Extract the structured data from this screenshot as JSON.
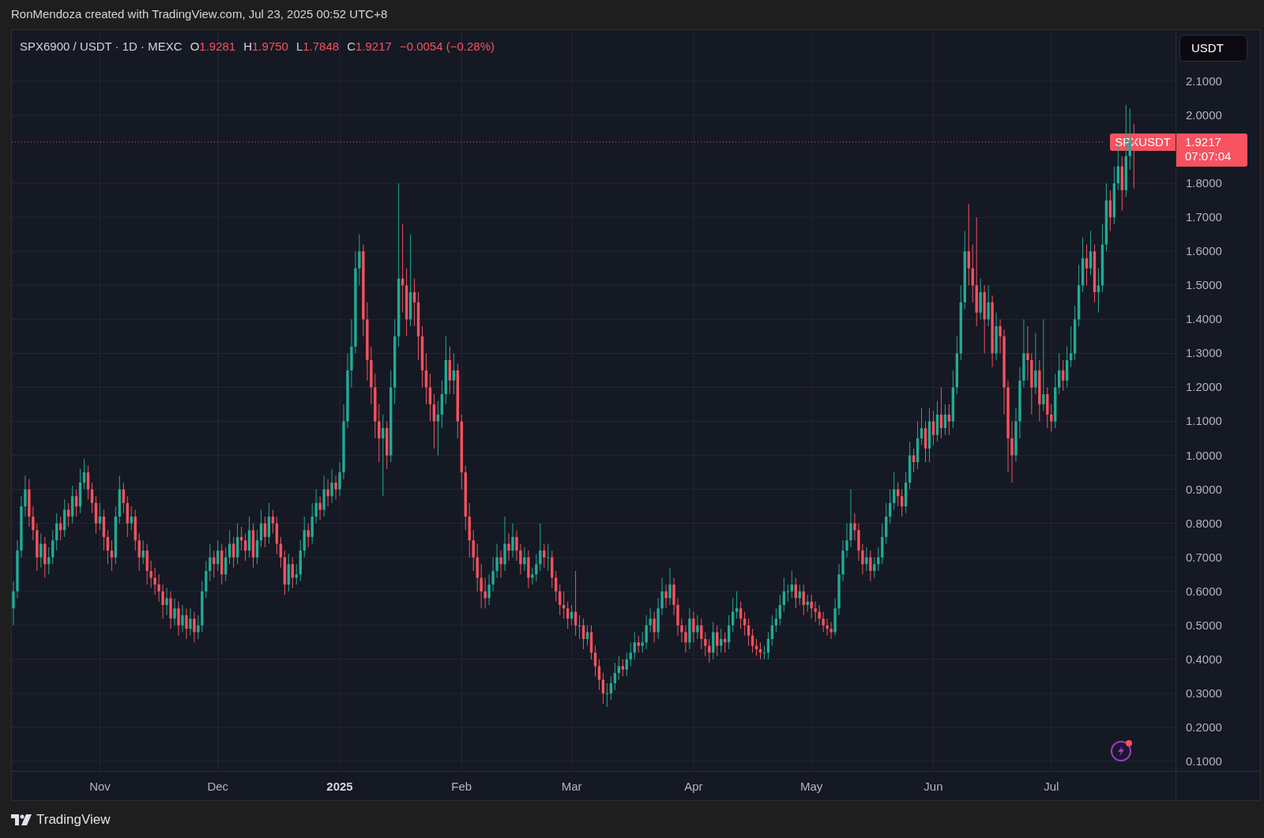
{
  "header": {
    "credit": "RonMendoza created with TradingView.com, Jul 23, 2025 00:52 UTC+8"
  },
  "legend": {
    "symbol": "SPX6900 / USDT · 1D · MEXC",
    "ohlc": [
      {
        "label": "O",
        "value": "1.9281"
      },
      {
        "label": "H",
        "value": "1.9750"
      },
      {
        "label": "L",
        "value": "1.7848"
      },
      {
        "label": "C",
        "value": "1.9217"
      }
    ],
    "change": "−0.0054 (−0.28%)"
  },
  "chart": {
    "chart_data": {
      "type": "candlestick",
      "ylim": [
        0.0721,
        2.251
      ],
      "grid": true,
      "ref_lines": [
        {
          "axis": "y",
          "value": 1.9217,
          "color": "#f7525f"
        }
      ],
      "categories": [
        null,
        null,
        null,
        null,
        null,
        null,
        null,
        null,
        null,
        null,
        null,
        null,
        null,
        null,
        null,
        null,
        null,
        null,
        null,
        null,
        null,
        null,
        "Nov",
        null,
        null,
        null,
        null,
        null,
        null,
        null,
        null,
        null,
        null,
        null,
        null,
        null,
        null,
        null,
        null,
        null,
        null,
        null,
        null,
        null,
        null,
        null,
        null,
        null,
        null,
        null,
        null,
        null,
        "Dec",
        null,
        null,
        null,
        null,
        null,
        null,
        null,
        null,
        null,
        null,
        null,
        null,
        null,
        null,
        null,
        null,
        null,
        null,
        null,
        null,
        null,
        null,
        null,
        null,
        null,
        null,
        null,
        null,
        null,
        null,
        "2025",
        null,
        null,
        null,
        null,
        null,
        null,
        null,
        null,
        null,
        null,
        null,
        null,
        null,
        null,
        null,
        null,
        null,
        null,
        null,
        null,
        null,
        null,
        null,
        null,
        null,
        null,
        null,
        null,
        null,
        null,
        "Feb",
        null,
        null,
        null,
        null,
        null,
        null,
        null,
        null,
        null,
        null,
        null,
        null,
        null,
        null,
        null,
        null,
        null,
        null,
        null,
        null,
        null,
        null,
        null,
        null,
        null,
        null,
        null,
        "Mar",
        null,
        null,
        null,
        null,
        null,
        null,
        null,
        null,
        null,
        null,
        null,
        null,
        null,
        null,
        null,
        null,
        null,
        null,
        null,
        null,
        null,
        null,
        null,
        null,
        null,
        null,
        null,
        null,
        null,
        null,
        "Apr",
        null,
        null,
        null,
        null,
        null,
        null,
        null,
        null,
        null,
        null,
        null,
        null,
        null,
        null,
        null,
        null,
        null,
        null,
        null,
        null,
        null,
        null,
        null,
        null,
        null,
        null,
        null,
        null,
        null,
        "May",
        null,
        null,
        null,
        null,
        null,
        null,
        null,
        null,
        null,
        null,
        null,
        null,
        null,
        null,
        null,
        null,
        null,
        null,
        null,
        null,
        null,
        null,
        null,
        null,
        null,
        null,
        null,
        null,
        null,
        null,
        "Jun",
        null,
        null,
        null,
        null,
        null,
        null,
        null,
        null,
        null,
        null,
        null,
        null,
        null,
        null,
        null,
        null,
        null,
        null,
        null,
        null,
        null,
        null,
        null,
        null,
        null,
        null,
        null,
        null,
        null,
        "Jul",
        null,
        null,
        null,
        null,
        null,
        null,
        null,
        null,
        null,
        null,
        null,
        null,
        null,
        null,
        null,
        null,
        null,
        null,
        null,
        null,
        null
      ],
      "yticks": [
        {
          "value": 2.1,
          "label": "2.1000"
        },
        {
          "value": 2.0,
          "label": "2.0000"
        },
        {
          "value": 1.8,
          "label": "1.8000"
        },
        {
          "value": 1.7,
          "label": "1.7000"
        },
        {
          "value": 1.6,
          "label": "1.6000"
        },
        {
          "value": 1.5,
          "label": "1.5000"
        },
        {
          "value": 1.4,
          "label": "1.4000"
        },
        {
          "value": 1.3,
          "label": "1.3000"
        },
        {
          "value": 1.2,
          "label": "1.2000"
        },
        {
          "value": 1.1,
          "label": "1.1000"
        },
        {
          "value": 1.0,
          "label": "1.0000"
        },
        {
          "value": 0.9,
          "label": "0.9000"
        },
        {
          "value": 0.8,
          "label": "0.8000"
        },
        {
          "value": 0.7,
          "label": "0.7000"
        },
        {
          "value": 0.6,
          "label": "0.6000"
        },
        {
          "value": 0.5,
          "label": "0.5000"
        },
        {
          "value": 0.4,
          "label": "0.4000"
        },
        {
          "value": 0.3,
          "label": "0.3000"
        },
        {
          "value": 0.2,
          "label": "0.2000"
        },
        {
          "value": 0.1,
          "label": "0.1000"
        }
      ],
      "ohlc": [
        [
          0.55,
          0.63,
          0.5,
          0.6
        ],
        [
          0.6,
          0.75,
          0.58,
          0.72
        ],
        [
          0.72,
          0.88,
          0.7,
          0.85
        ],
        [
          0.85,
          0.94,
          0.82,
          0.9
        ],
        [
          0.9,
          0.93,
          0.79,
          0.82
        ],
        [
          0.82,
          0.85,
          0.75,
          0.78
        ],
        [
          0.78,
          0.8,
          0.66,
          0.7
        ],
        [
          0.7,
          0.77,
          0.67,
          0.74
        ],
        [
          0.74,
          0.76,
          0.64,
          0.68
        ],
        [
          0.68,
          0.73,
          0.65,
          0.7
        ],
        [
          0.7,
          0.78,
          0.68,
          0.75
        ],
        [
          0.75,
          0.83,
          0.72,
          0.8
        ],
        [
          0.8,
          0.82,
          0.75,
          0.78
        ],
        [
          0.78,
          0.87,
          0.76,
          0.84
        ],
        [
          0.84,
          0.86,
          0.79,
          0.82
        ],
        [
          0.82,
          0.91,
          0.8,
          0.88
        ],
        [
          0.88,
          0.9,
          0.82,
          0.85
        ],
        [
          0.85,
          0.96,
          0.83,
          0.92
        ],
        [
          0.92,
          0.99,
          0.9,
          0.95
        ],
        [
          0.95,
          0.97,
          0.87,
          0.9
        ],
        [
          0.9,
          0.92,
          0.83,
          0.86
        ],
        [
          0.86,
          0.88,
          0.77,
          0.8
        ],
        [
          0.8,
          0.86,
          0.78,
          0.82
        ],
        [
          0.82,
          0.84,
          0.72,
          0.76
        ],
        [
          0.76,
          0.78,
          0.68,
          0.72
        ],
        [
          0.72,
          0.75,
          0.66,
          0.7
        ],
        [
          0.7,
          0.85,
          0.68,
          0.82
        ],
        [
          0.82,
          0.94,
          0.8,
          0.9
        ],
        [
          0.9,
          0.92,
          0.83,
          0.86
        ],
        [
          0.86,
          0.88,
          0.76,
          0.8
        ],
        [
          0.8,
          0.85,
          0.78,
          0.82
        ],
        [
          0.82,
          0.84,
          0.72,
          0.75
        ],
        [
          0.75,
          0.77,
          0.66,
          0.7
        ],
        [
          0.7,
          0.75,
          0.68,
          0.72
        ],
        [
          0.72,
          0.74,
          0.62,
          0.66
        ],
        [
          0.66,
          0.69,
          0.61,
          0.64
        ],
        [
          0.64,
          0.67,
          0.59,
          0.62
        ],
        [
          0.62,
          0.65,
          0.57,
          0.6
        ],
        [
          0.6,
          0.62,
          0.52,
          0.56
        ],
        [
          0.56,
          0.61,
          0.53,
          0.58
        ],
        [
          0.58,
          0.6,
          0.49,
          0.52
        ],
        [
          0.52,
          0.58,
          0.5,
          0.55
        ],
        [
          0.55,
          0.57,
          0.47,
          0.5
        ],
        [
          0.5,
          0.56,
          0.48,
          0.53
        ],
        [
          0.53,
          0.55,
          0.46,
          0.49
        ],
        [
          0.49,
          0.55,
          0.47,
          0.52
        ],
        [
          0.52,
          0.54,
          0.45,
          0.48
        ],
        [
          0.48,
          0.53,
          0.46,
          0.5
        ],
        [
          0.5,
          0.63,
          0.48,
          0.6
        ],
        [
          0.6,
          0.69,
          0.58,
          0.66
        ],
        [
          0.66,
          0.74,
          0.63,
          0.7
        ],
        [
          0.7,
          0.72,
          0.64,
          0.68
        ],
        [
          0.68,
          0.75,
          0.66,
          0.72
        ],
        [
          0.72,
          0.74,
          0.62,
          0.65
        ],
        [
          0.65,
          0.73,
          0.63,
          0.7
        ],
        [
          0.7,
          0.78,
          0.68,
          0.74
        ],
        [
          0.74,
          0.76,
          0.67,
          0.7
        ],
        [
          0.7,
          0.8,
          0.68,
          0.76
        ],
        [
          0.76,
          0.79,
          0.72,
          0.75
        ],
        [
          0.75,
          0.77,
          0.69,
          0.72
        ],
        [
          0.72,
          0.82,
          0.7,
          0.78
        ],
        [
          0.78,
          0.8,
          0.67,
          0.7
        ],
        [
          0.7,
          0.78,
          0.68,
          0.75
        ],
        [
          0.75,
          0.84,
          0.73,
          0.8
        ],
        [
          0.8,
          0.82,
          0.73,
          0.76
        ],
        [
          0.76,
          0.86,
          0.74,
          0.82
        ],
        [
          0.82,
          0.84,
          0.77,
          0.8
        ],
        [
          0.8,
          0.82,
          0.71,
          0.74
        ],
        [
          0.74,
          0.76,
          0.67,
          0.7
        ],
        [
          0.7,
          0.72,
          0.59,
          0.62
        ],
        [
          0.62,
          0.71,
          0.6,
          0.68
        ],
        [
          0.68,
          0.7,
          0.61,
          0.64
        ],
        [
          0.64,
          0.68,
          0.62,
          0.65
        ],
        [
          0.65,
          0.75,
          0.63,
          0.72
        ],
        [
          0.72,
          0.82,
          0.7,
          0.78
        ],
        [
          0.78,
          0.8,
          0.73,
          0.76
        ],
        [
          0.76,
          0.86,
          0.74,
          0.82
        ],
        [
          0.82,
          0.9,
          0.8,
          0.86
        ],
        [
          0.86,
          0.88,
          0.81,
          0.84
        ],
        [
          0.84,
          0.94,
          0.82,
          0.9
        ],
        [
          0.9,
          0.93,
          0.85,
          0.88
        ],
        [
          0.88,
          0.96,
          0.86,
          0.92
        ],
        [
          0.92,
          0.94,
          0.87,
          0.9
        ],
        [
          0.9,
          0.98,
          0.88,
          0.95
        ],
        [
          0.95,
          1.15,
          0.93,
          1.1
        ],
        [
          1.1,
          1.3,
          1.08,
          1.25
        ],
        [
          1.25,
          1.4,
          1.2,
          1.32
        ],
        [
          1.32,
          1.6,
          1.3,
          1.55
        ],
        [
          1.55,
          1.65,
          1.5,
          1.6
        ],
        [
          1.6,
          1.62,
          1.35,
          1.4
        ],
        [
          1.4,
          1.45,
          1.22,
          1.28
        ],
        [
          1.28,
          1.32,
          1.15,
          1.2
        ],
        [
          1.2,
          1.24,
          1.05,
          1.1
        ],
        [
          1.1,
          1.15,
          0.98,
          1.05
        ],
        [
          1.05,
          1.12,
          0.88,
          1.08
        ],
        [
          1.08,
          1.1,
          0.96,
          1.0
        ],
        [
          1.0,
          1.25,
          0.98,
          1.2
        ],
        [
          1.2,
          1.4,
          1.15,
          1.35
        ],
        [
          1.35,
          1.8,
          1.32,
          1.52
        ],
        [
          1.52,
          1.68,
          1.42,
          1.5
        ],
        [
          1.5,
          1.55,
          1.35,
          1.4
        ],
        [
          1.4,
          1.65,
          1.38,
          1.48
        ],
        [
          1.48,
          1.52,
          1.38,
          1.45
        ],
        [
          1.45,
          1.48,
          1.28,
          1.35
        ],
        [
          1.35,
          1.38,
          1.2,
          1.25
        ],
        [
          1.25,
          1.3,
          1.15,
          1.2
        ],
        [
          1.2,
          1.24,
          1.1,
          1.15
        ],
        [
          1.15,
          1.18,
          1.02,
          1.1
        ],
        [
          1.1,
          1.16,
          1.0,
          1.12
        ],
        [
          1.12,
          1.22,
          1.08,
          1.18
        ],
        [
          1.18,
          1.35,
          1.15,
          1.28
        ],
        [
          1.28,
          1.32,
          1.18,
          1.22
        ],
        [
          1.22,
          1.3,
          1.18,
          1.25
        ],
        [
          1.25,
          1.27,
          1.05,
          1.1
        ],
        [
          1.1,
          1.12,
          0.9,
          0.95
        ],
        [
          0.95,
          0.97,
          0.78,
          0.82
        ],
        [
          0.82,
          0.86,
          0.7,
          0.75
        ],
        [
          0.75,
          0.78,
          0.66,
          0.7
        ],
        [
          0.7,
          0.74,
          0.6,
          0.64
        ],
        [
          0.64,
          0.68,
          0.55,
          0.6
        ],
        [
          0.6,
          0.64,
          0.55,
          0.58
        ],
        [
          0.58,
          0.65,
          0.56,
          0.62
        ],
        [
          0.62,
          0.7,
          0.6,
          0.66
        ],
        [
          0.66,
          0.74,
          0.64,
          0.7
        ],
        [
          0.7,
          0.72,
          0.64,
          0.68
        ],
        [
          0.68,
          0.82,
          0.66,
          0.74
        ],
        [
          0.74,
          0.77,
          0.69,
          0.72
        ],
        [
          0.72,
          0.8,
          0.7,
          0.76
        ],
        [
          0.76,
          0.78,
          0.69,
          0.72
        ],
        [
          0.72,
          0.74,
          0.65,
          0.68
        ],
        [
          0.68,
          0.73,
          0.66,
          0.7
        ],
        [
          0.7,
          0.72,
          0.61,
          0.64
        ],
        [
          0.64,
          0.67,
          0.62,
          0.65
        ],
        [
          0.65,
          0.71,
          0.63,
          0.68
        ],
        [
          0.68,
          0.8,
          0.66,
          0.72
        ],
        [
          0.72,
          0.74,
          0.67,
          0.7
        ],
        [
          0.7,
          0.74,
          0.66,
          0.7
        ],
        [
          0.7,
          0.72,
          0.61,
          0.64
        ],
        [
          0.64,
          0.66,
          0.57,
          0.6
        ],
        [
          0.6,
          0.62,
          0.53,
          0.56
        ],
        [
          0.56,
          0.6,
          0.52,
          0.55
        ],
        [
          0.55,
          0.57,
          0.49,
          0.52
        ],
        [
          0.52,
          0.56,
          0.5,
          0.54
        ],
        [
          0.54,
          0.66,
          0.47,
          0.5
        ],
        [
          0.5,
          0.53,
          0.46,
          0.5
        ],
        [
          0.5,
          0.52,
          0.43,
          0.46
        ],
        [
          0.46,
          0.5,
          0.44,
          0.48
        ],
        [
          0.48,
          0.5,
          0.4,
          0.42
        ],
        [
          0.42,
          0.44,
          0.35,
          0.38
        ],
        [
          0.38,
          0.4,
          0.31,
          0.34
        ],
        [
          0.34,
          0.36,
          0.27,
          0.3
        ],
        [
          0.3,
          0.33,
          0.26,
          0.3
        ],
        [
          0.3,
          0.35,
          0.28,
          0.33
        ],
        [
          0.33,
          0.39,
          0.31,
          0.36
        ],
        [
          0.36,
          0.41,
          0.34,
          0.38
        ],
        [
          0.38,
          0.4,
          0.35,
          0.37
        ],
        [
          0.37,
          0.42,
          0.35,
          0.4
        ],
        [
          0.4,
          0.45,
          0.38,
          0.42
        ],
        [
          0.42,
          0.48,
          0.4,
          0.45
        ],
        [
          0.45,
          0.47,
          0.42,
          0.44
        ],
        [
          0.44,
          0.48,
          0.42,
          0.45
        ],
        [
          0.45,
          0.53,
          0.43,
          0.5
        ],
        [
          0.5,
          0.55,
          0.48,
          0.52
        ],
        [
          0.52,
          0.54,
          0.45,
          0.48
        ],
        [
          0.48,
          0.58,
          0.46,
          0.55
        ],
        [
          0.55,
          0.64,
          0.53,
          0.6
        ],
        [
          0.6,
          0.62,
          0.55,
          0.58
        ],
        [
          0.58,
          0.67,
          0.56,
          0.62
        ],
        [
          0.62,
          0.64,
          0.53,
          0.56
        ],
        [
          0.56,
          0.58,
          0.47,
          0.5
        ],
        [
          0.5,
          0.52,
          0.45,
          0.48
        ],
        [
          0.48,
          0.5,
          0.42,
          0.45
        ],
        [
          0.45,
          0.55,
          0.43,
          0.52
        ],
        [
          0.52,
          0.54,
          0.45,
          0.48
        ],
        [
          0.48,
          0.53,
          0.46,
          0.5
        ],
        [
          0.5,
          0.52,
          0.43,
          0.46
        ],
        [
          0.46,
          0.48,
          0.41,
          0.44
        ],
        [
          0.44,
          0.46,
          0.39,
          0.42
        ],
        [
          0.42,
          0.51,
          0.4,
          0.48
        ],
        [
          0.48,
          0.5,
          0.41,
          0.44
        ],
        [
          0.44,
          0.49,
          0.42,
          0.46
        ],
        [
          0.46,
          0.48,
          0.42,
          0.45
        ],
        [
          0.45,
          0.53,
          0.43,
          0.5
        ],
        [
          0.5,
          0.58,
          0.48,
          0.54
        ],
        [
          0.54,
          0.6,
          0.52,
          0.55
        ],
        [
          0.55,
          0.57,
          0.49,
          0.52
        ],
        [
          0.52,
          0.54,
          0.47,
          0.5
        ],
        [
          0.5,
          0.52,
          0.44,
          0.47
        ],
        [
          0.47,
          0.49,
          0.42,
          0.44
        ],
        [
          0.44,
          0.46,
          0.41,
          0.43
        ],
        [
          0.43,
          0.45,
          0.4,
          0.42
        ],
        [
          0.42,
          0.44,
          0.4,
          0.42
        ],
        [
          0.42,
          0.48,
          0.4,
          0.46
        ],
        [
          0.46,
          0.53,
          0.44,
          0.5
        ],
        [
          0.5,
          0.55,
          0.48,
          0.52
        ],
        [
          0.52,
          0.59,
          0.5,
          0.56
        ],
        [
          0.56,
          0.64,
          0.54,
          0.6
        ],
        [
          0.6,
          0.62,
          0.57,
          0.6
        ],
        [
          0.6,
          0.66,
          0.58,
          0.62
        ],
        [
          0.62,
          0.64,
          0.55,
          0.58
        ],
        [
          0.58,
          0.62,
          0.56,
          0.6
        ],
        [
          0.6,
          0.62,
          0.53,
          0.56
        ],
        [
          0.56,
          0.59,
          0.54,
          0.57
        ],
        [
          0.57,
          0.59,
          0.52,
          0.55
        ],
        [
          0.55,
          0.57,
          0.51,
          0.54
        ],
        [
          0.54,
          0.56,
          0.5,
          0.52
        ],
        [
          0.52,
          0.54,
          0.48,
          0.5
        ],
        [
          0.5,
          0.52,
          0.47,
          0.49
        ],
        [
          0.49,
          0.51,
          0.46,
          0.48
        ],
        [
          0.48,
          0.58,
          0.47,
          0.55
        ],
        [
          0.55,
          0.68,
          0.53,
          0.65
        ],
        [
          0.65,
          0.75,
          0.63,
          0.72
        ],
        [
          0.72,
          0.8,
          0.7,
          0.75
        ],
        [
          0.75,
          0.9,
          0.73,
          0.8
        ],
        [
          0.8,
          0.83,
          0.75,
          0.78
        ],
        [
          0.78,
          0.8,
          0.69,
          0.72
        ],
        [
          0.72,
          0.74,
          0.65,
          0.68
        ],
        [
          0.68,
          0.73,
          0.66,
          0.7
        ],
        [
          0.7,
          0.72,
          0.63,
          0.66
        ],
        [
          0.66,
          0.7,
          0.64,
          0.68
        ],
        [
          0.68,
          0.73,
          0.66,
          0.7
        ],
        [
          0.7,
          0.8,
          0.68,
          0.76
        ],
        [
          0.76,
          0.86,
          0.74,
          0.82
        ],
        [
          0.82,
          0.9,
          0.8,
          0.86
        ],
        [
          0.86,
          0.95,
          0.84,
          0.9
        ],
        [
          0.9,
          0.92,
          0.85,
          0.88
        ],
        [
          0.88,
          0.9,
          0.82,
          0.85
        ],
        [
          0.85,
          0.95,
          0.83,
          0.92
        ],
        [
          0.92,
          1.04,
          0.9,
          1.0
        ],
        [
          1.0,
          1.02,
          0.95,
          0.98
        ],
        [
          0.98,
          1.1,
          0.96,
          1.05
        ],
        [
          1.05,
          1.14,
          1.03,
          1.08
        ],
        [
          1.08,
          1.1,
          0.98,
          1.02
        ],
        [
          1.02,
          1.14,
          0.98,
          1.1
        ],
        [
          1.1,
          1.13,
          1.03,
          1.06
        ],
        [
          1.06,
          1.16,
          1.04,
          1.12
        ],
        [
          1.12,
          1.2,
          1.05,
          1.08
        ],
        [
          1.08,
          1.15,
          1.06,
          1.12
        ],
        [
          1.12,
          1.15,
          1.06,
          1.1
        ],
        [
          1.1,
          1.25,
          1.08,
          1.2
        ],
        [
          1.2,
          1.35,
          1.18,
          1.3
        ],
        [
          1.3,
          1.5,
          1.28,
          1.45
        ],
        [
          1.45,
          1.66,
          1.43,
          1.6
        ],
        [
          1.6,
          1.74,
          1.5,
          1.55
        ],
        [
          1.55,
          1.62,
          1.45,
          1.5
        ],
        [
          1.5,
          1.7,
          1.38,
          1.42
        ],
        [
          1.42,
          1.52,
          1.4,
          1.48
        ],
        [
          1.48,
          1.5,
          1.3,
          1.4
        ],
        [
          1.4,
          1.5,
          1.38,
          1.45
        ],
        [
          1.45,
          1.47,
          1.26,
          1.3
        ],
        [
          1.3,
          1.42,
          1.28,
          1.38
        ],
        [
          1.38,
          1.4,
          1.3,
          1.35
        ],
        [
          1.35,
          1.37,
          1.12,
          1.2
        ],
        [
          1.2,
          1.22,
          0.95,
          1.05
        ],
        [
          1.05,
          1.1,
          0.92,
          1.0
        ],
        [
          1.0,
          1.14,
          0.98,
          1.1
        ],
        [
          1.1,
          1.26,
          1.05,
          1.22
        ],
        [
          1.22,
          1.4,
          1.2,
          1.3
        ],
        [
          1.3,
          1.38,
          1.22,
          1.28
        ],
        [
          1.28,
          1.3,
          1.12,
          1.2
        ],
        [
          1.2,
          1.36,
          1.18,
          1.25
        ],
        [
          1.25,
          1.28,
          1.1,
          1.15
        ],
        [
          1.15,
          1.4,
          1.13,
          1.18
        ],
        [
          1.18,
          1.2,
          1.08,
          1.12
        ],
        [
          1.12,
          1.15,
          1.07,
          1.1
        ],
        [
          1.1,
          1.24,
          1.08,
          1.2
        ],
        [
          1.2,
          1.3,
          1.18,
          1.25
        ],
        [
          1.25,
          1.28,
          1.19,
          1.22
        ],
        [
          1.22,
          1.32,
          1.2,
          1.28
        ],
        [
          1.28,
          1.38,
          1.26,
          1.3
        ],
        [
          1.3,
          1.44,
          1.28,
          1.4
        ],
        [
          1.4,
          1.56,
          1.38,
          1.5
        ],
        [
          1.5,
          1.64,
          1.48,
          1.58
        ],
        [
          1.58,
          1.62,
          1.5,
          1.55
        ],
        [
          1.55,
          1.66,
          1.53,
          1.6
        ],
        [
          1.6,
          1.62,
          1.45,
          1.48
        ],
        [
          1.48,
          1.55,
          1.42,
          1.5
        ],
        [
          1.5,
          1.68,
          1.48,
          1.62
        ],
        [
          1.62,
          1.8,
          1.6,
          1.75
        ],
        [
          1.75,
          1.78,
          1.66,
          1.7
        ],
        [
          1.7,
          1.85,
          1.68,
          1.8
        ],
        [
          1.8,
          1.92,
          1.78,
          1.85
        ],
        [
          1.85,
          1.88,
          1.72,
          1.78
        ],
        [
          1.78,
          2.03,
          1.76,
          1.88
        ],
        [
          1.88,
          2.02,
          1.84,
          1.9281
        ],
        [
          1.9281,
          1.975,
          1.7848,
          1.9217
        ]
      ]
    }
  },
  "price_axis": {
    "currency": "USDT"
  },
  "last_price": {
    "symbol": "SPXUSDT",
    "price": "1.9217",
    "countdown": "07:07:04"
  },
  "time_axis": [
    {
      "bold": false
    },
    {
      "bold": false
    },
    {
      "bold": true
    },
    {
      "bold": false
    },
    {
      "bold": false
    },
    {
      "bold": false
    },
    {
      "bold": false
    },
    {
      "bold": false
    },
    {
      "bold": false
    }
  ],
  "footer": {
    "brand": "TradingView"
  }
}
